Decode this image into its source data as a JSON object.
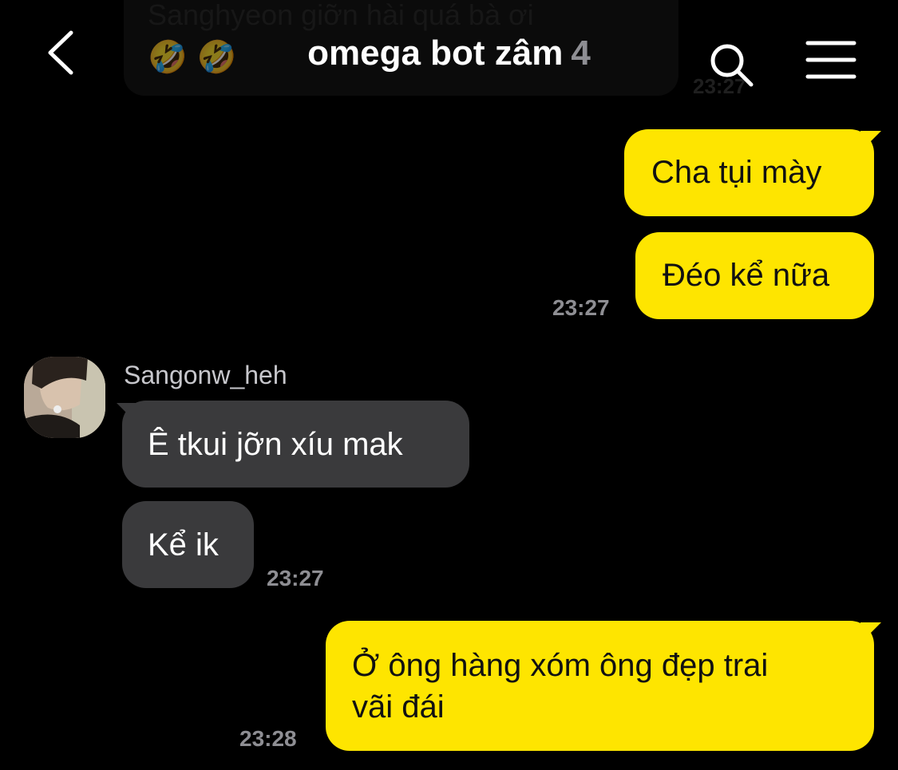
{
  "header": {
    "title": "omega bot zâm",
    "member_count": "4",
    "back_icon": "chevron-left-icon",
    "search_icon": "search-icon",
    "menu_icon": "hamburger-menu-icon"
  },
  "faded_message": {
    "text": "Sanghyeon giỡn hài quá bà ơi",
    "emojis": "🤣🤣",
    "time": "23:27"
  },
  "messages": [
    {
      "direction": "out",
      "text": "Cha tụi mày"
    },
    {
      "direction": "out",
      "text": "Đéo kể nữa",
      "time": "23:27"
    },
    {
      "direction": "in",
      "sender": "Sangonw_heh",
      "text": "Ê tkui jỡn xíu mak"
    },
    {
      "direction": "in",
      "text": "Kể ik",
      "time": "23:27"
    },
    {
      "direction": "out",
      "text_line1": "Ở ông hàng xóm ông đẹp trai",
      "text_line2": "vãi đái",
      "time": "23:28"
    }
  ],
  "colors": {
    "outgoing_bubble": "#fee500",
    "incoming_bubble": "#3a3a3c",
    "background": "#000000",
    "timestamp": "#8e8e93"
  }
}
